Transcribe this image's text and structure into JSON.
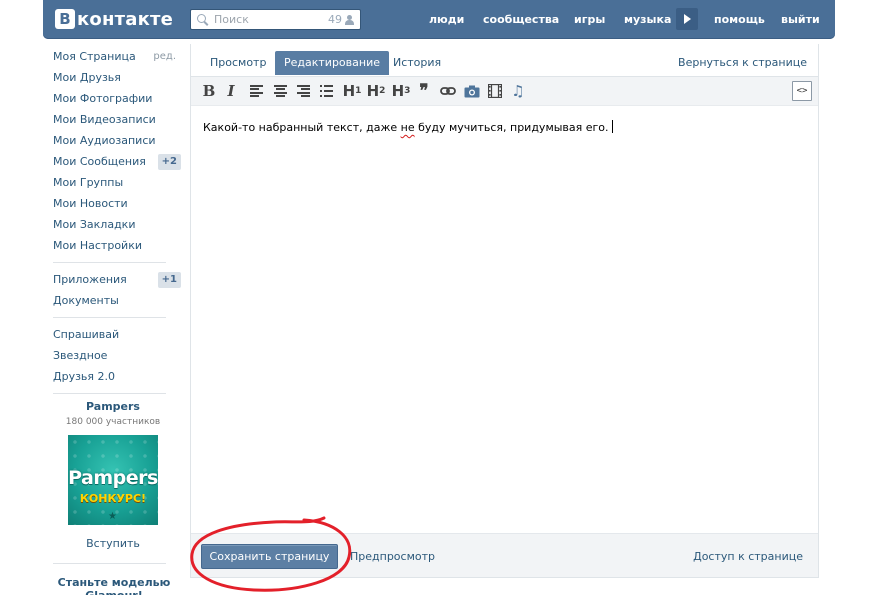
{
  "header": {
    "logo_letter": "В",
    "logo_text": "контакте",
    "search_placeholder": "Поиск",
    "search_count": "49",
    "nav": [
      "люди",
      "сообщества",
      "игры",
      "музыка",
      "помощь",
      "выйти"
    ]
  },
  "sidebar": {
    "items": [
      {
        "label": "Моя Страница",
        "extra": "ред."
      },
      {
        "label": "Мои Друзья"
      },
      {
        "label": "Мои Фотографии"
      },
      {
        "label": "Мои Видеозаписи"
      },
      {
        "label": "Мои Аудиозаписи"
      },
      {
        "label": "Мои Сообщения",
        "badge": "+2"
      },
      {
        "label": "Мои Группы"
      },
      {
        "label": "Мои Новости"
      },
      {
        "label": "Мои Закладки"
      },
      {
        "label": "Мои Настройки"
      }
    ],
    "apps": [
      {
        "label": "Приложения",
        "badge": "+1"
      },
      {
        "label": "Документы"
      }
    ],
    "extra_apps": [
      {
        "label": "Спрашивай"
      },
      {
        "label": "Звездное"
      },
      {
        "label": "Друзья 2.0"
      }
    ],
    "ad": {
      "title": "Pampers",
      "subtitle": "180 000 участников",
      "image_logo": "Pampers",
      "image_caption": "КОНКУРС!",
      "join_label": "Вступить"
    },
    "ad2": {
      "title": "Станьте моделью Glamour!"
    }
  },
  "tabs": [
    {
      "label": "Просмотр"
    },
    {
      "label": "Редактирование",
      "active": true
    },
    {
      "label": "История"
    }
  ],
  "back_link": "Вернуться к странице",
  "toolbar": {
    "bold": "B",
    "italic": "I",
    "h1": "H",
    "h1_sub": "1",
    "h2": "H",
    "h2_sub": "2",
    "h3": "H",
    "h3_sub": "3",
    "quote": "❞",
    "code": "<>"
  },
  "editor": {
    "text_before": "Какой-то набранный текст, даже ",
    "typo_word": "не",
    "text_after": " буду мучиться, придумывая его."
  },
  "footer": {
    "save_label": "Сохранить страницу",
    "preview_label": "Предпросмотр",
    "access_label": "Доступ к странице"
  },
  "colors": {
    "header_bg": "#4a6f97",
    "link": "#2b587a",
    "active_tab": "#597da3",
    "save_button": "#5c7fa4",
    "annotation": "#e3202a"
  }
}
